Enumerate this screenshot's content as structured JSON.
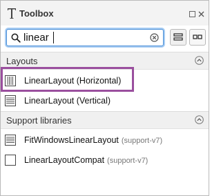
{
  "window": {
    "title": "Toolbox"
  },
  "search": {
    "value": "linear"
  },
  "sections": [
    {
      "label": "Layouts",
      "items": [
        {
          "label": "LinearLayout (Horizontal)",
          "sub": "",
          "icon": "linear-layout-horizontal-icon"
        },
        {
          "label": "LinearLayout (Vertical)",
          "sub": "",
          "icon": "linear-layout-vertical-icon"
        }
      ]
    },
    {
      "label": "Support libraries",
      "items": [
        {
          "label": "FitWindowsLinearLayout",
          "sub": "(support-v7)",
          "icon": "fit-windows-linear-layout-icon"
        },
        {
          "label": "LinearLayoutCompat",
          "sub": "(support-v7)",
          "icon": "linear-layout-compat-icon"
        }
      ]
    }
  ],
  "colors": {
    "highlight": "#9a4f9e",
    "focus": "#4a8fd8"
  }
}
